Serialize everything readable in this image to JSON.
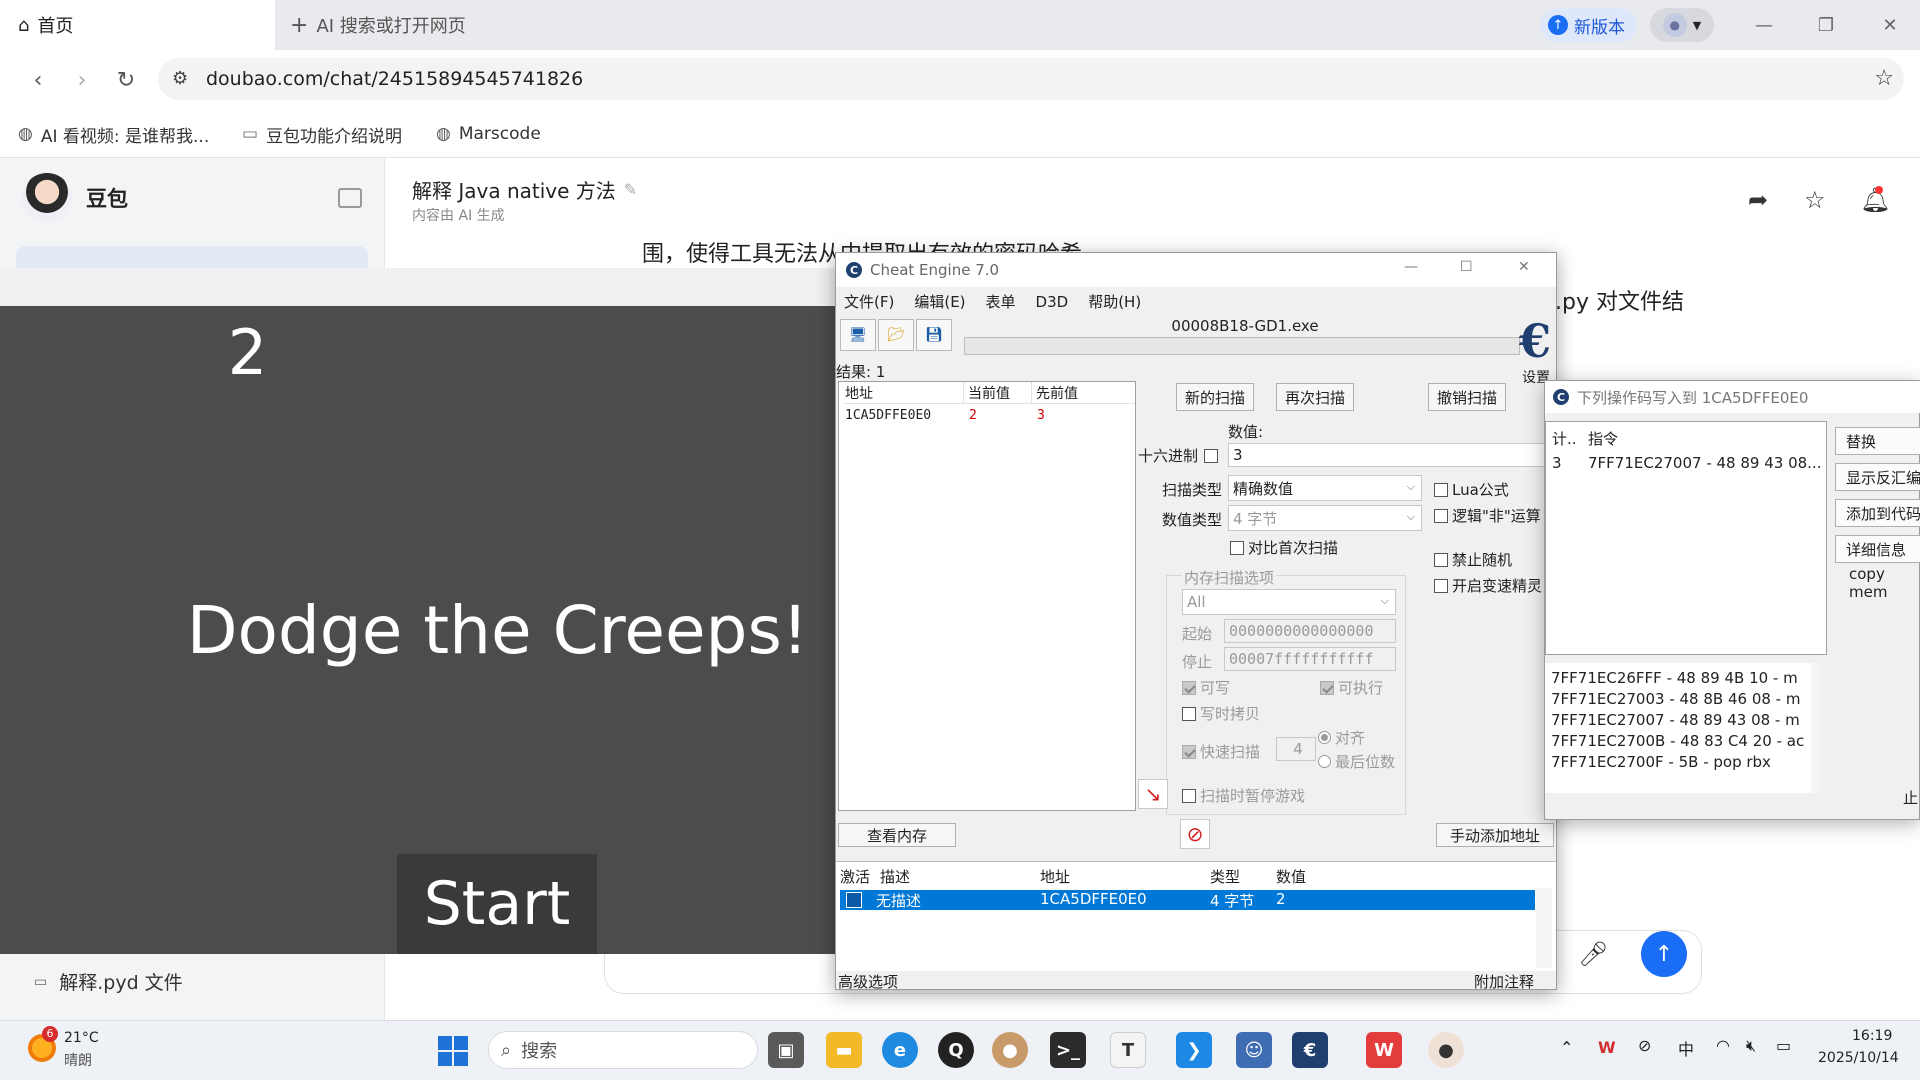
{
  "browser": {
    "active_tab": "首页",
    "new_tab": "AI 搜索或打开网页",
    "new_version": "新版本",
    "url": "doubao.com/chat/24515894545741826",
    "bookmarks": [
      "AI 看视频: 是谁帮我...",
      "豆包功能介绍说明",
      "Marscode"
    ]
  },
  "doubao": {
    "brand": "豆包",
    "chat_title": "解释 Java native 方法",
    "chat_subtitle": "内容由 AI 生成",
    "body_line1": "围，使得工具无法从中提取出有效的密码哈希值",
    "body_fragment": ".py 对文件结",
    "sidebar_item": "解释.pyd 文件"
  },
  "game": {
    "score": "2",
    "title": "Dodge the Creeps!",
    "start_button": "Start"
  },
  "cheat_engine": {
    "window_title": "Cheat Engine 7.0",
    "menu": [
      "文件(F)",
      "编辑(E)",
      "表单",
      "D3D",
      "帮助(H)"
    ],
    "process": "00008B18-GD1.exe",
    "settings_label": "设置",
    "results_label": "结果: 1",
    "list_headers": [
      "地址",
      "当前值",
      "先前值"
    ],
    "list_rows": [
      {
        "address": "1CA5DFFE0E0",
        "current": "2",
        "previous": "3"
      }
    ],
    "buttons": {
      "new_scan": "新的扫描",
      "next_scan": "再次扫描",
      "undo_scan": "撤销扫描",
      "view_memory": "查看内存",
      "add_address": "手动添加地址"
    },
    "value_label": "数值:",
    "hex_label": "十六进制",
    "value": "3",
    "scan_type_label": "扫描类型",
    "scan_type": "精确数值",
    "value_type_label": "数值类型",
    "value_type": "4 字节",
    "compare_first": "对比首次扫描",
    "lua_formula": "Lua公式",
    "logic_not": "逻辑\"非\"运算",
    "no_random": "禁止随机",
    "speedhack": "开启变速精灵",
    "mem_options_label": "内存扫描选项",
    "mem_region": "All",
    "start_label": "起始",
    "start_value": "0000000000000000",
    "stop_label": "停止",
    "stop_value": "00007fffffffffff",
    "writable": "可写",
    "executable": "可执行",
    "copy_on_write": "写时拷贝",
    "fast_scan": "快速扫描",
    "fast_scan_value": "4",
    "align": "对齐",
    "last_digits": "最后位数",
    "pause_game": "扫描时暂停游戏",
    "table_headers": [
      "激活",
      "描述",
      "地址",
      "类型",
      "数值"
    ],
    "table_row": {
      "description": "无描述",
      "address": "1CA5DFFE0E0",
      "type": "4 字节",
      "value": "2"
    },
    "advanced": "高级选项",
    "add_comment": "附加注释"
  },
  "popup": {
    "title": "下列操作码写入到 1CA5DFFE0E0",
    "headers": [
      "计..",
      "指令"
    ],
    "rows": [
      {
        "count": "3",
        "instruction": "7FF71EC27007 - 48 89 43 08..."
      }
    ],
    "buttons": [
      "替换",
      "显示反汇编",
      "添加到代码",
      "详细信息"
    ],
    "copy_label": "copy mem",
    "disasm": [
      "7FF71EC26FFF - 48 89 4B 10  - m",
      "7FF71EC27003 - 48 8B 46 08  - m",
      "7FF71EC27007 - 48 89 43 08  - m",
      "7FF71EC2700B - 48 83 C4 20 - ac",
      "7FF71EC2700F - 5B - pop rbx"
    ],
    "stop_fragment": "止"
  },
  "taskbar": {
    "weather_badge": "6",
    "temperature": "21°C",
    "weather": "晴朗",
    "search": "搜索",
    "ime": "中",
    "time": "16:19",
    "date": "2025/10/14"
  },
  "colors": {
    "accent": "#1a6ef5",
    "ce_selection": "#0078d7",
    "game_bg": "#4c4c4c",
    "red_value": "#d00000"
  }
}
